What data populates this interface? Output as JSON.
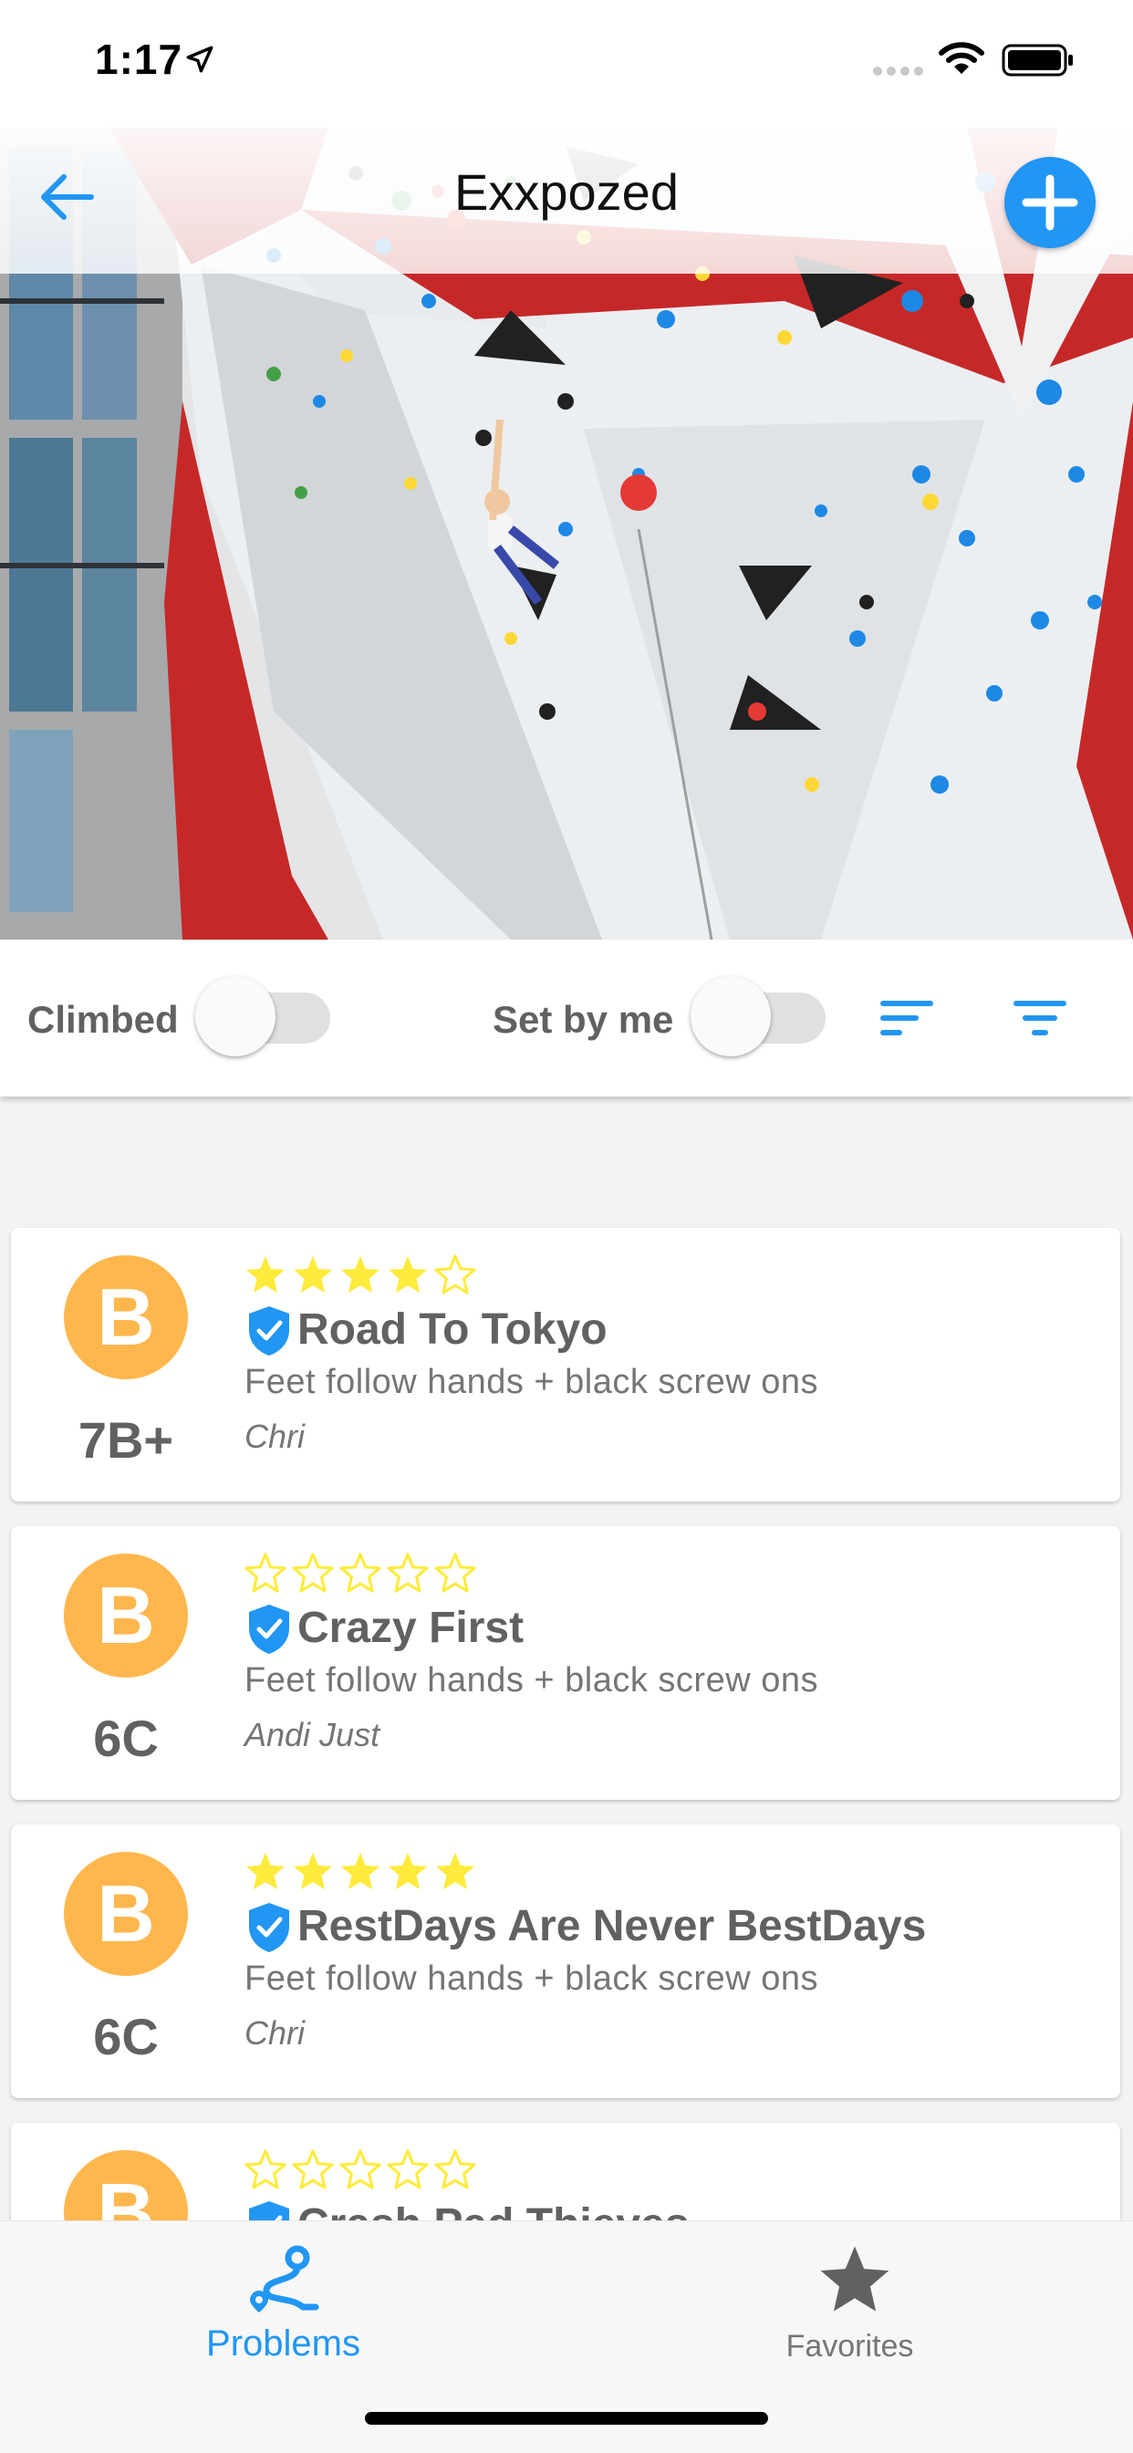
{
  "status_bar": {
    "time": "1:17"
  },
  "header": {
    "title": "Exxpozed"
  },
  "filters": {
    "climbed_label": "Climbed",
    "climbed_on": false,
    "set_by_me_label": "Set by me",
    "set_by_me_on": false
  },
  "problems": [
    {
      "badge": "B",
      "grade": "7B+",
      "rating": 4,
      "name": "Road To Tokyo",
      "description": "Feet follow hands + black screw ons",
      "setter": "Chri"
    },
    {
      "badge": "B",
      "grade": "6C",
      "rating": 0,
      "name": "Crazy First",
      "description": "Feet follow hands + black screw ons",
      "setter": "Andi Just"
    },
    {
      "badge": "B",
      "grade": "6C",
      "rating": 5,
      "name": "RestDays Are Never BestDays",
      "description": "Feet follow hands + black screw ons",
      "setter": "Chri"
    },
    {
      "badge": "B",
      "grade": "",
      "rating": 0,
      "name": "Crash Pad Thieves",
      "description": "",
      "setter": ""
    }
  ],
  "bottom_nav": {
    "problems_label": "Problems",
    "favorites_label": "Favorites",
    "active": "problems"
  },
  "colors": {
    "accent": "#2196f3",
    "badge": "#ffb74d",
    "star": "#ffeb3b",
    "grade_text": "#616161",
    "wall_red": "#c62828"
  }
}
